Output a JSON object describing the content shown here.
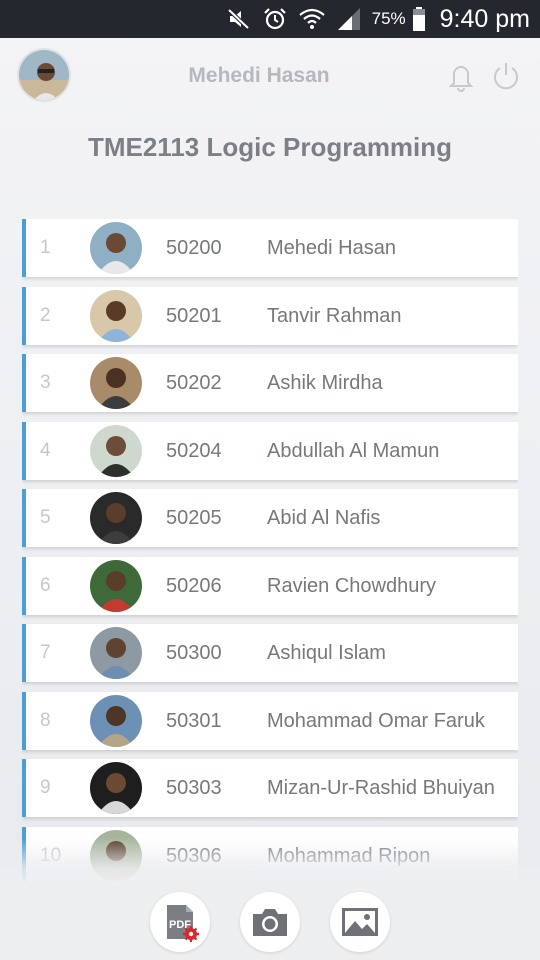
{
  "status_bar": {
    "battery_percent": "75%",
    "time": "9:40 pm",
    "icons": [
      "mute-icon",
      "alarm-icon",
      "wifi-icon",
      "signal-icon",
      "battery-icon"
    ]
  },
  "header": {
    "user_name": "Mehedi Hasan",
    "icons": [
      "avatar",
      "bell-icon",
      "power-icon"
    ]
  },
  "course_title": "TME2113 Logic Programming",
  "accent_color": "#4a9fd6",
  "students": [
    {
      "index": "1",
      "id": "50200",
      "name": "Mehedi Hasan"
    },
    {
      "index": "2",
      "id": "50201",
      "name": "Tanvir Rahman"
    },
    {
      "index": "3",
      "id": "50202",
      "name": "Ashik Mirdha"
    },
    {
      "index": "4",
      "id": "50204",
      "name": "Abdullah Al Mamun"
    },
    {
      "index": "5",
      "id": "50205",
      "name": "Abid Al Nafis"
    },
    {
      "index": "6",
      "id": "50206",
      "name": "Ravien Chowdhury"
    },
    {
      "index": "7",
      "id": "50300",
      "name": "Ashiqul Islam"
    },
    {
      "index": "8",
      "id": "50301",
      "name": "Mohammad Omar Faruk"
    },
    {
      "index": "9",
      "id": "50303",
      "name": "Mizan-Ur-Rashid Bhuiyan"
    },
    {
      "index": "10",
      "id": "50306",
      "name": "Mohammad Ripon"
    }
  ],
  "bottom_bar": {
    "pdf_label": "PDF",
    "icons": [
      "pdf-settings-icon",
      "camera-icon",
      "gallery-icon"
    ]
  }
}
